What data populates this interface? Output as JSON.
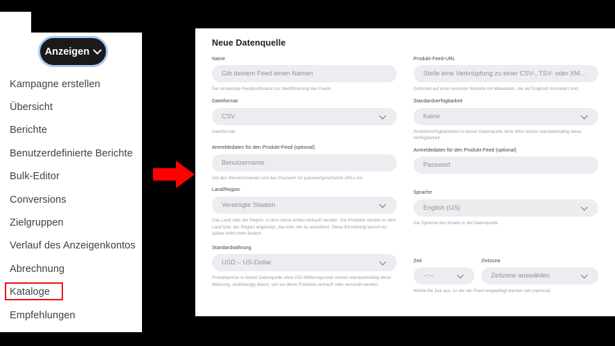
{
  "nav": {
    "button": {
      "label": "Anzeigen",
      "icon": "chevron-down-icon"
    },
    "items": [
      {
        "label": "Kampagne erstellen",
        "highlighted": false
      },
      {
        "label": "Übersicht",
        "highlighted": false
      },
      {
        "label": "Berichte",
        "highlighted": false
      },
      {
        "label": "Benutzerdefinierte Berichte",
        "highlighted": false
      },
      {
        "label": "Bulk-Editor",
        "highlighted": false
      },
      {
        "label": "Conversions",
        "highlighted": false
      },
      {
        "label": "Zielgruppen",
        "highlighted": false
      },
      {
        "label": "Verlauf des Anzeigenkontos",
        "highlighted": false
      },
      {
        "label": "Abrechnung",
        "highlighted": false
      },
      {
        "label": "Kataloge",
        "highlighted": true
      },
      {
        "label": "Empfehlungen",
        "highlighted": false
      }
    ]
  },
  "annotation": {
    "arrow_icon": "right-arrow-icon",
    "arrow_color": "#ff0000",
    "highlight_color": "#ee1111"
  },
  "form": {
    "title": "Neue Datenquelle",
    "left_column": {
      "name": {
        "label": "Name",
        "placeholder": "Gib deinem Feed einen Namen",
        "value": "",
        "helper": "Der eindeutige Feedprofilname zur Identifizierung des Feeds"
      },
      "file_format": {
        "label": "Dateiformat",
        "value": "CSV",
        "helper": "Dateiformat",
        "icon": "chevron-down-icon"
      },
      "credentials": {
        "label": "Anmeldedaten für den Produkt-Feed (optional)",
        "placeholder": "Benutzername",
        "value": "",
        "helper": "Gib den Benutzernamen und das Passwort für passwortgeschützte URLs ein"
      },
      "country_region": {
        "label": "Land/Region",
        "value": "Vereinigte Staaten",
        "helper": "Das Land oder die Region, in dem deine Artikel verkauft werden. Die Produkte werden in dem Land bzw. der Region angezeigt, das bzw. die du auswählst. Diese Einstellung kannst du später nicht mehr ändern.",
        "icon": "chevron-down-icon"
      },
      "default_currency": {
        "label": "Standardwährung",
        "value": "USD – US-Dollar",
        "helper": "Produktpreise in deiner Datenquelle ohne ISO-Währungscode nutzen standardmäßig diese Währung, unabhängig davon, von wo deine Produkte verkauft oder versandt werden.",
        "icon": "chevron-down-icon"
      }
    },
    "right_column": {
      "feed_url": {
        "label": "Produkt-Feed-URL",
        "placeholder": "Stelle eine Verknüpfung zu einer CSV-, TSV- oder XML- Datei ...",
        "value": "",
        "helper": "Gehostet auf einer externen Website mit Metadaten, die auf Englisch formatiert sind"
      },
      "default_availability": {
        "label": "Standardverfügbarkeit",
        "value": "Keine",
        "helper": "Produktverfügbarkeiten in deiner Datenquelle ohne Wert nutzen standardmäßig diese Verfügbarkeit.",
        "icon": "chevron-down-icon"
      },
      "credentials": {
        "label": "Anmeldedaten für den Produkt-Feed (optional)",
        "placeholder": "Passwort",
        "value": "",
        "helper": ""
      },
      "language": {
        "label": "Sprache",
        "value": "English (US)",
        "helper": "Die Sprache des Inhalts in der Datenquelle",
        "icon": "chevron-down-icon"
      },
      "time": {
        "label": "Zeit",
        "value": "--:--",
        "icon": "chevron-down-icon"
      },
      "timezone": {
        "label": "Zeitzone",
        "value": "Zeitzone auswählen",
        "icon": "chevron-down-icon"
      },
      "time_helper": "Wähle die Zeit aus, zu der der Feed eingepflegt werden soll (optional)"
    }
  }
}
